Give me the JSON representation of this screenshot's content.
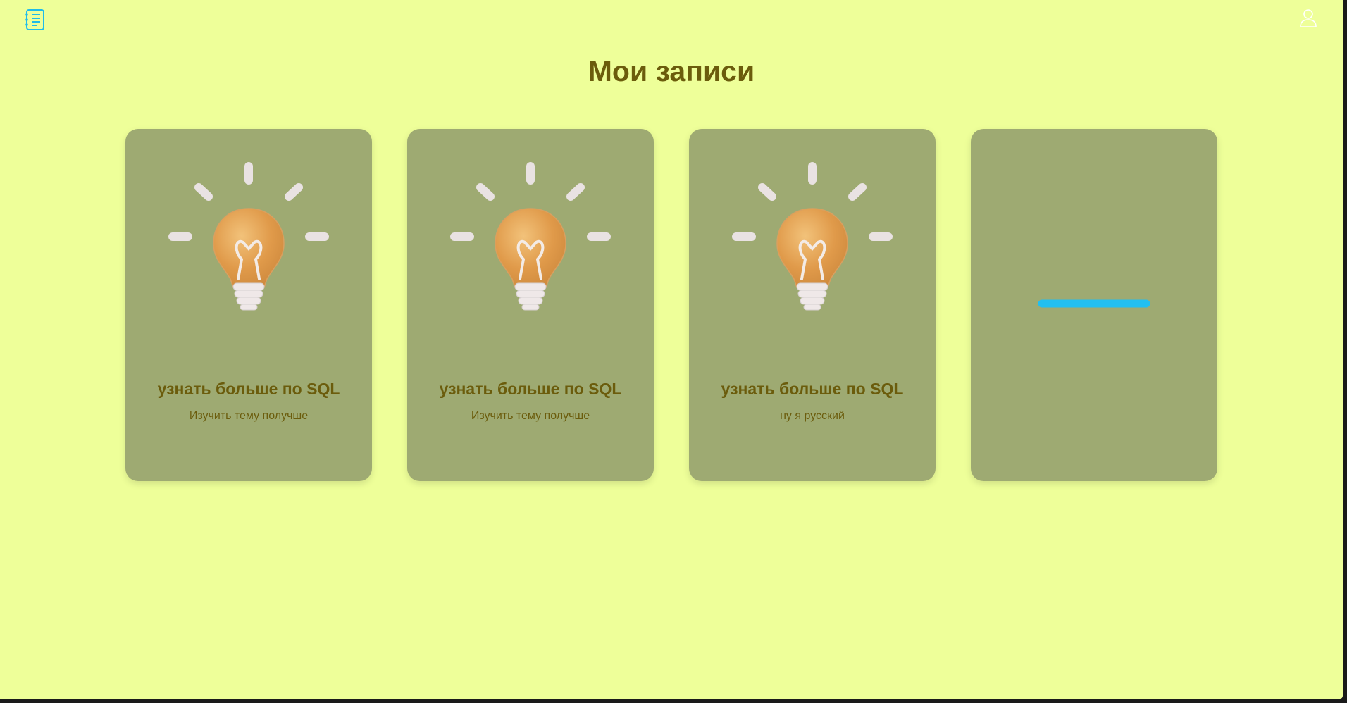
{
  "header": {
    "logo_icon": "notebook-list-icon",
    "profile_icon": "user-icon",
    "accent": "#1fbcea"
  },
  "page": {
    "title": "Мои записи"
  },
  "notes": [
    {
      "title": "узнать больше по SQL",
      "description": "Изучить тему получше",
      "image_icon": "lightbulb-icon"
    },
    {
      "title": "узнать больше по SQL",
      "description": "Изучить тему получше",
      "image_icon": "lightbulb-icon"
    },
    {
      "title": "узнать больше по SQL",
      "description": "ну я русский",
      "image_icon": "lightbulb-icon"
    }
  ],
  "add_card": {
    "icon": "plus-icon",
    "color": "#1fbcea"
  },
  "colors": {
    "background": "#eeff99",
    "card": "#9eaa72",
    "text": "#6b5c0c"
  }
}
